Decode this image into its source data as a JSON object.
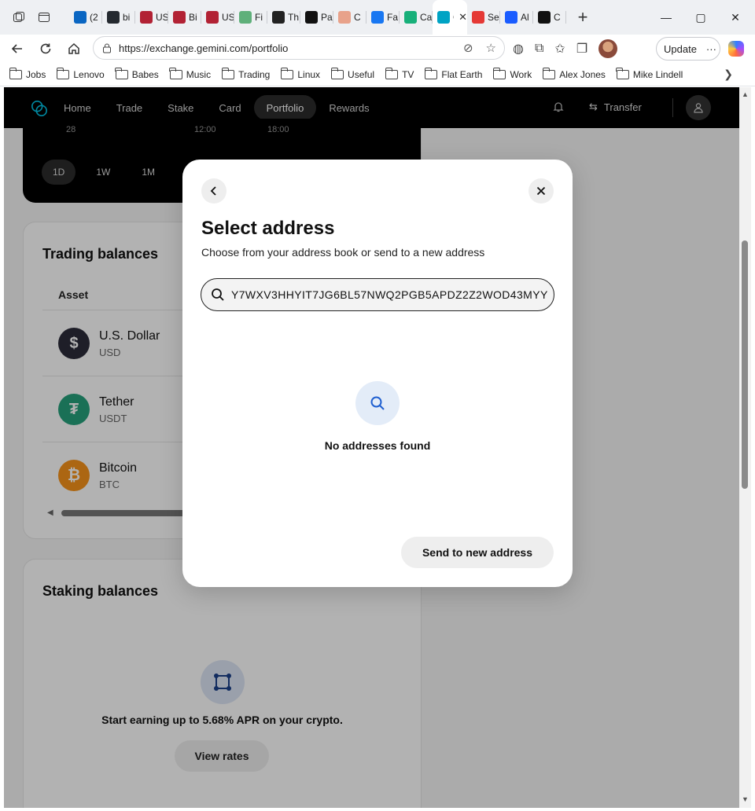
{
  "browser": {
    "tabs": [
      {
        "text": "(2",
        "icon": "linkedin-icon",
        "color": "#0a66c2"
      },
      {
        "text": "bi",
        "icon": "github-icon",
        "color": "#24292f"
      },
      {
        "text": "US",
        "icon": "flag-icon",
        "color": "#b22234"
      },
      {
        "text": "Bi",
        "icon": "flag-icon",
        "color": "#b22234"
      },
      {
        "text": "US",
        "icon": "flag-icon",
        "color": "#b22234"
      },
      {
        "text": "Fi",
        "icon": "fi-icon",
        "color": "#5fb07a"
      },
      {
        "text": "Th",
        "icon": "amazon-icon",
        "color": "#222222"
      },
      {
        "text": "Pa",
        "icon": "openai-icon",
        "color": "#111111"
      },
      {
        "text": "C",
        "icon": "image-icon",
        "color": "#e8a28a"
      },
      {
        "text": "Fa",
        "icon": "facebook-icon",
        "color": "#1877f2"
      },
      {
        "text": "Ca",
        "icon": "k-icon",
        "color": "#18b07a"
      },
      {
        "text": "G",
        "icon": "gemini-icon",
        "color": "#00a3c4",
        "active": true
      },
      {
        "text": "Se",
        "icon": "s-icon",
        "color": "#e53935"
      },
      {
        "text": "Al",
        "icon": "c-icon",
        "color": "#1a5cff"
      },
      {
        "text": "C",
        "icon": "circle-icon",
        "color": "#111111"
      }
    ],
    "url": "https://exchange.gemini.com/portfolio",
    "update_label": "Update",
    "bookmarks": [
      "Jobs",
      "Lenovo",
      "Babes",
      "Music",
      "Trading",
      "Linux",
      "Useful",
      "TV",
      "Flat Earth",
      "Work",
      "Alex Jones",
      "Mike Lindell"
    ]
  },
  "site": {
    "nav": [
      "Home",
      "Trade",
      "Stake",
      "Card",
      "Portfolio",
      "Rewards"
    ],
    "active_nav": "Portfolio",
    "transfer_label": "Transfer",
    "chart_labels": [
      "28",
      "12:00",
      "18:00"
    ],
    "ranges": [
      "1D",
      "1W",
      "1M"
    ],
    "active_range": "1D",
    "trading_title": "Trading balances",
    "asset_header": "Asset",
    "assets": [
      {
        "name": "U.S. Dollar",
        "code": "USD",
        "symbol": "$",
        "color": "#2b2b3a"
      },
      {
        "name": "Tether",
        "code": "USDT",
        "symbol": "₮",
        "color": "#26a17b"
      },
      {
        "name": "Bitcoin",
        "code": "BTC",
        "symbol": "₿",
        "color": "#f7931a"
      }
    ],
    "staking_title": "Staking balances",
    "staking_text": "Start earning up to 5.68% APR on your crypto.",
    "view_rates_label": "View rates"
  },
  "modal": {
    "title": "Select address",
    "subtitle": "Choose from your address book or send to a new address",
    "search_value": "Y7WXV3HHYIT7JG6BL57NWQ2PGB5APDZ2Z2WOD43MYY",
    "empty_text": "No addresses found",
    "send_label": "Send to new address"
  }
}
